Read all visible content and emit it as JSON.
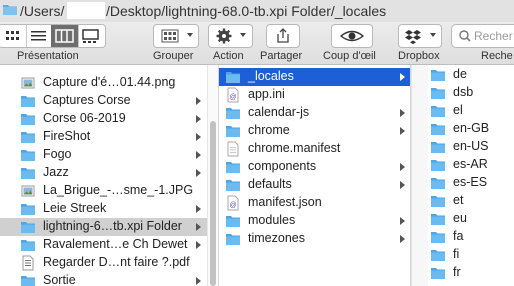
{
  "path": {
    "part1": "/Users/",
    "part2": "/Desktop/lightning-68.0-tb.xpi Folder/_locales"
  },
  "toolbar": {
    "presentation": "Présentation",
    "grouper": "Grouper",
    "action": "Action",
    "partager": "Partager",
    "coup": "Coup d'œil",
    "dropbox": "Dropbox",
    "search_label": "Reche",
    "search_placeholder": "Recher"
  },
  "col1": [
    {
      "label": "Capture d'é…01.44.png",
      "icon": "image-file-icon",
      "folder": false
    },
    {
      "label": "Captures Corse",
      "icon": "folder-icon",
      "folder": true
    },
    {
      "label": "Corse 06-2019",
      "icon": "folder-icon",
      "folder": true
    },
    {
      "label": "FireShot",
      "icon": "folder-icon",
      "folder": true
    },
    {
      "label": "Fogo",
      "icon": "folder-icon",
      "folder": true
    },
    {
      "label": "Jazz",
      "icon": "folder-icon",
      "folder": true
    },
    {
      "label": "La_Brigue_-…sme_-1.JPG",
      "icon": "image-file-icon",
      "folder": false
    },
    {
      "label": "Leie Streek",
      "icon": "folder-icon",
      "folder": true
    },
    {
      "label": "lightning-6…tb.xpi Folder",
      "icon": "folder-icon",
      "folder": true,
      "selected": true
    },
    {
      "label": "Ravalement…e Ch Dewet",
      "icon": "folder-icon",
      "folder": true
    },
    {
      "label": "Regarder D…nt faire ?.pdf",
      "icon": "pdf-file-icon",
      "folder": false
    },
    {
      "label": "Sortie",
      "icon": "folder-icon",
      "folder": true
    }
  ],
  "col2": [
    {
      "label": "_locales",
      "icon": "folder-icon",
      "folder": true,
      "selected": true
    },
    {
      "label": "app.ini",
      "icon": "script-file-icon",
      "folder": false
    },
    {
      "label": "calendar-js",
      "icon": "folder-icon",
      "folder": true
    },
    {
      "label": "chrome",
      "icon": "folder-icon",
      "folder": true
    },
    {
      "label": "chrome.manifest",
      "icon": "document-file-icon",
      "folder": false
    },
    {
      "label": "components",
      "icon": "folder-icon",
      "folder": true
    },
    {
      "label": "defaults",
      "icon": "folder-icon",
      "folder": true
    },
    {
      "label": "manifest.json",
      "icon": "script-file-icon",
      "folder": false
    },
    {
      "label": "modules",
      "icon": "folder-icon",
      "folder": true
    },
    {
      "label": "timezones",
      "icon": "folder-icon",
      "folder": true
    }
  ],
  "col3": [
    {
      "label": "de"
    },
    {
      "label": "dsb"
    },
    {
      "label": "el"
    },
    {
      "label": "en-GB"
    },
    {
      "label": "en-US"
    },
    {
      "label": "es-AR"
    },
    {
      "label": "es-ES"
    },
    {
      "label": "et"
    },
    {
      "label": "eu"
    },
    {
      "label": "fa"
    },
    {
      "label": "fi"
    },
    {
      "label": "fr"
    }
  ]
}
